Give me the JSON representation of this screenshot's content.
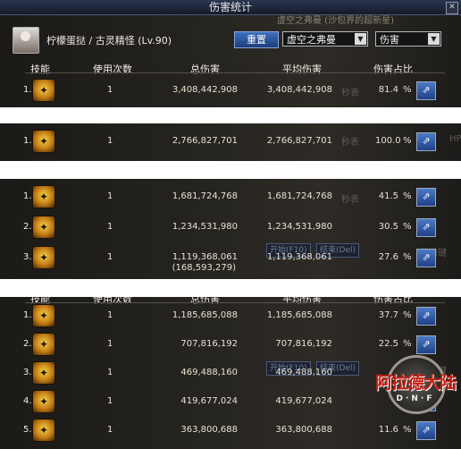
{
  "window": {
    "title": "伤害统计",
    "close_icon": "close-icon"
  },
  "header": {
    "character": "柠檬蛋挞 / 古灵精怪 (Lv.90)",
    "reset_label": "重置",
    "dungeon_select": "虚空之弗曼",
    "metric_select": "伤害",
    "background_dropdown_text": "虚空之弗曼 (沙包界的超新星)"
  },
  "columns": {
    "skill": "技能",
    "uses": "使用次数",
    "total": "总伤害",
    "avg": "平均伤害",
    "share": "伤害占比"
  },
  "panels": [
    {
      "show_header": true,
      "rows": [
        {
          "idx": "1.",
          "icon": "skill-icon",
          "uses": "1",
          "total": "3,408,442,908",
          "avg": "3,408,442,908",
          "pct": "81.4"
        }
      ]
    },
    {
      "show_header": false,
      "rows": [
        {
          "idx": "1.",
          "icon": "skill-icon",
          "uses": "1",
          "total": "2,766,827,701",
          "avg": "2,766,827,701",
          "pct": "100.0"
        }
      ]
    },
    {
      "show_header": false,
      "rows": [
        {
          "idx": "1.",
          "icon": "skill-icon",
          "uses": "1",
          "total": "1,681,724,768",
          "avg": "1,681,724,768",
          "pct": "41.5"
        },
        {
          "idx": "2.",
          "icon": "skill-icon",
          "uses": "1",
          "total": "1,234,531,980",
          "avg": "1,234,531,980",
          "pct": "30.5"
        },
        {
          "idx": "3.",
          "icon": "skill-icon",
          "uses": "1",
          "total": "1,119,368,061",
          "avg": "1,119,368,061",
          "pct": "27.6",
          "sub": "(168,593,279)"
        }
      ]
    },
    {
      "show_header": true,
      "rows": [
        {
          "idx": "1.",
          "icon": "skill-icon",
          "uses": "1",
          "total": "1,185,685,088",
          "avg": "1,185,685,088",
          "pct": "37.7"
        },
        {
          "idx": "2.",
          "icon": "skill-icon",
          "uses": "1",
          "total": "707,816,192",
          "avg": "707,816,192",
          "pct": "22.5"
        },
        {
          "idx": "3.",
          "icon": "skill-icon",
          "uses": "1",
          "total": "469,488,160",
          "avg": "469,488,160",
          "pct": ""
        },
        {
          "idx": "4.",
          "icon": "skill-icon",
          "uses": "1",
          "total": "419,677,024",
          "avg": "419,677,024",
          "pct": ""
        },
        {
          "idx": "5.",
          "icon": "skill-icon",
          "uses": "1",
          "total": "363,800,688",
          "avg": "363,800,688",
          "pct": "11.6"
        }
      ]
    }
  ],
  "pct_sign": "%",
  "share_icon": "share-icon",
  "background_text": {
    "seconds": "秒表",
    "hint": "使用键",
    "ghost_btn_a": "开始(F10)",
    "ghost_btn_b": "结束(Del)",
    "label_hp": "HP"
  },
  "watermark": {
    "title": "阿拉德大陆",
    "subtitle": "D·N·F"
  }
}
